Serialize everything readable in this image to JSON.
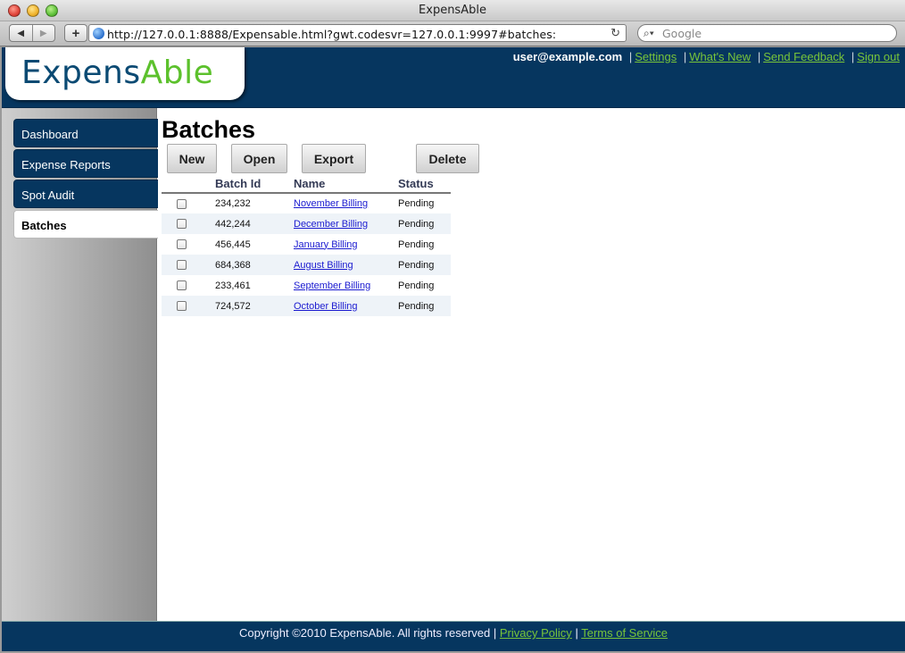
{
  "browser": {
    "window_title": "ExpensAble",
    "url": "http://127.0.0.1:8888/Expensable.html?gwt.codesvr=127.0.0.1:9997#batches:",
    "search_placeholder": "Google",
    "back_icon": "◀",
    "forward_icon": "▶",
    "add_icon": "+",
    "reload_icon": "↻",
    "search_icon": "⌕▾"
  },
  "header": {
    "logo_part1": "Expens",
    "logo_part2": "Able",
    "user": "user@example.com",
    "sep": "|",
    "links": [
      "Settings",
      "What's New",
      "Send Feedback",
      "Sign out"
    ]
  },
  "sidebar": {
    "items": [
      {
        "label": "Dashboard",
        "active": false
      },
      {
        "label": "Expense Reports",
        "active": false
      },
      {
        "label": "Spot Audit",
        "active": false
      },
      {
        "label": "Batches",
        "active": true
      }
    ]
  },
  "main": {
    "title": "Batches",
    "buttons": [
      "New",
      "Open",
      "Export",
      "Delete"
    ],
    "columns": [
      "Batch Id",
      "Name",
      "Status"
    ],
    "rows": [
      {
        "id": "234,232",
        "name": "November Billing",
        "status": "Pending"
      },
      {
        "id": "442,244",
        "name": "December Billing",
        "status": "Pending"
      },
      {
        "id": "456,445",
        "name": "January Billing",
        "status": "Pending"
      },
      {
        "id": "684,368",
        "name": "August Billing",
        "status": "Pending"
      },
      {
        "id": "233,461",
        "name": "September Billing",
        "status": "Pending"
      },
      {
        "id": "724,572",
        "name": "October Billing",
        "status": "Pending"
      }
    ]
  },
  "footer": {
    "copyright": "Copyright ©2010 ExpensAble. All rights reserved",
    "sep": "|",
    "privacy": "Privacy Policy",
    "terms": "Terms of Service"
  }
}
